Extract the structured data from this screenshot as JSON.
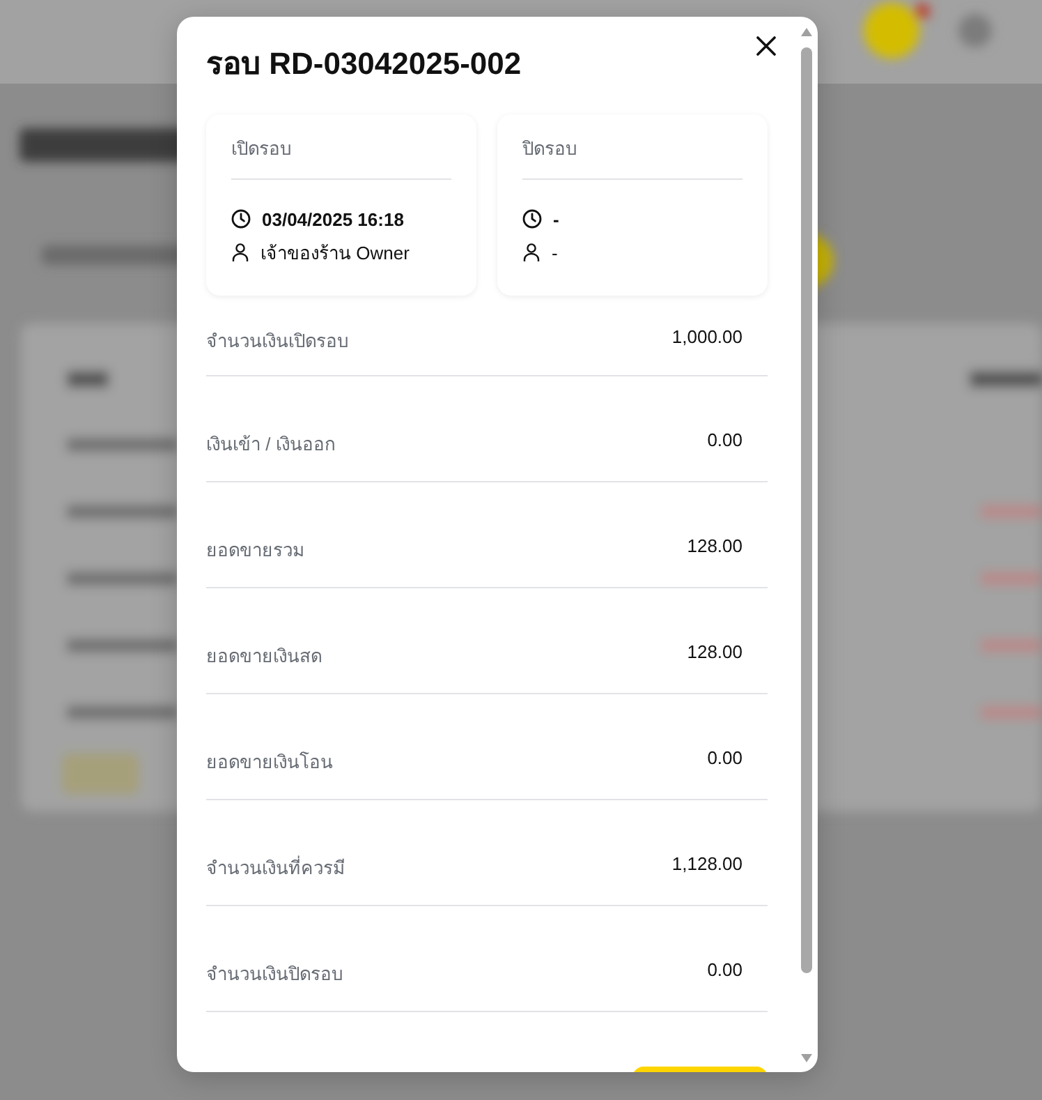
{
  "dialog": {
    "title": "รอบ RD-03042025-002",
    "cards": [
      {
        "heading": "เปิดรอบ",
        "time": "03/04/2025 16:18",
        "user": "เจ้าของร้าน Owner"
      },
      {
        "heading": "ปิดรอบ",
        "time": "-",
        "user": "-"
      }
    ],
    "summary_rows": [
      {
        "label": "จำนวนเงินเปิดรอบ",
        "value": "1,000.00"
      },
      {
        "label": "เงินเข้า / เงินออก",
        "value": "0.00"
      },
      {
        "label": "ยอดขายรวม",
        "value": "128.00"
      },
      {
        "label": "ยอดขายเงินสด",
        "value": "128.00"
      },
      {
        "label": "ยอดขายเงินโอน",
        "value": "0.00"
      },
      {
        "label": "จำนวนเงินที่ควรมี",
        "value": "1,128.00"
      },
      {
        "label": "จำนวนเงินปิดรอบ",
        "value": "0.00"
      }
    ]
  }
}
